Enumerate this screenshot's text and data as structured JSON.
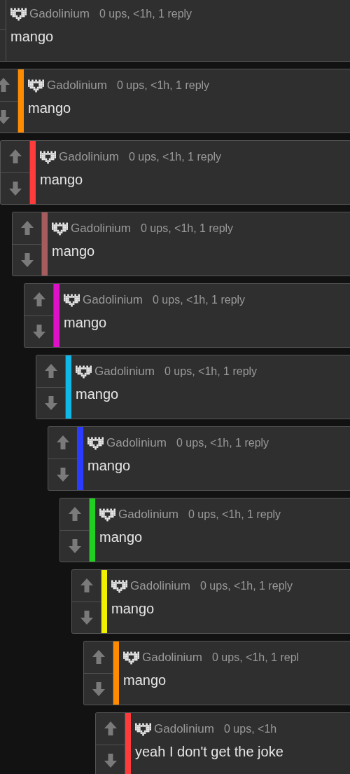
{
  "thread": [
    {
      "author": "Gadolinium",
      "meta": "0 ups, <1h, 1 reply",
      "text": "mango",
      "children": [
        {
          "author": "Gadolinium",
          "meta": "0 ups, <1h, 1 reply",
          "text": "mango",
          "color": "#ff8c00",
          "children": [
            {
              "author": "Gadolinium",
              "meta": "0 ups, <1h, 1 reply",
              "text": "mango",
              "color": "#ff3b3b",
              "children": [
                {
                  "author": "Gadolinium",
                  "meta": "0 ups, <1h, 1 reply",
                  "text": "mango",
                  "color": "#a65c5c",
                  "children": [
                    {
                      "author": "Gadolinium",
                      "meta": "0 ups, <1h, 1 reply",
                      "text": "mango",
                      "color": "#e010c8",
                      "children": [
                        {
                          "author": "Gadolinium",
                          "meta": "0 ups, <1h, 1 reply",
                          "text": "mango",
                          "color": "#10b8e8",
                          "children": [
                            {
                              "author": "Gadolinium",
                              "meta": "0 ups, <1h, 1 reply",
                              "text": "mango",
                              "color": "#2b3bff",
                              "children": [
                                {
                                  "author": "Gadolinium",
                                  "meta": "0 ups, <1h, 1 reply",
                                  "text": "mango",
                                  "color": "#20d020",
                                  "children": [
                                    {
                                      "author": "Gadolinium",
                                      "meta": "0 ups, <1h, 1 reply",
                                      "text": "mango",
                                      "color": "#f0f000",
                                      "children": [
                                        {
                                          "author": "Gadolinium",
                                          "meta": "0 ups, <1h, 1 repl",
                                          "text": "mango",
                                          "color": "#ff8c00",
                                          "children": [
                                            {
                                              "author": "Gadolinium",
                                              "meta": "0 ups, <1h",
                                              "text": "yeah I don't get the joke",
                                              "color": "#ff3b3b"
                                            }
                                          ]
                                        }
                                      ]
                                    }
                                  ]
                                }
                              ]
                            }
                          ]
                        }
                      ]
                    }
                  ]
                }
              ]
            }
          ]
        }
      ]
    }
  ]
}
